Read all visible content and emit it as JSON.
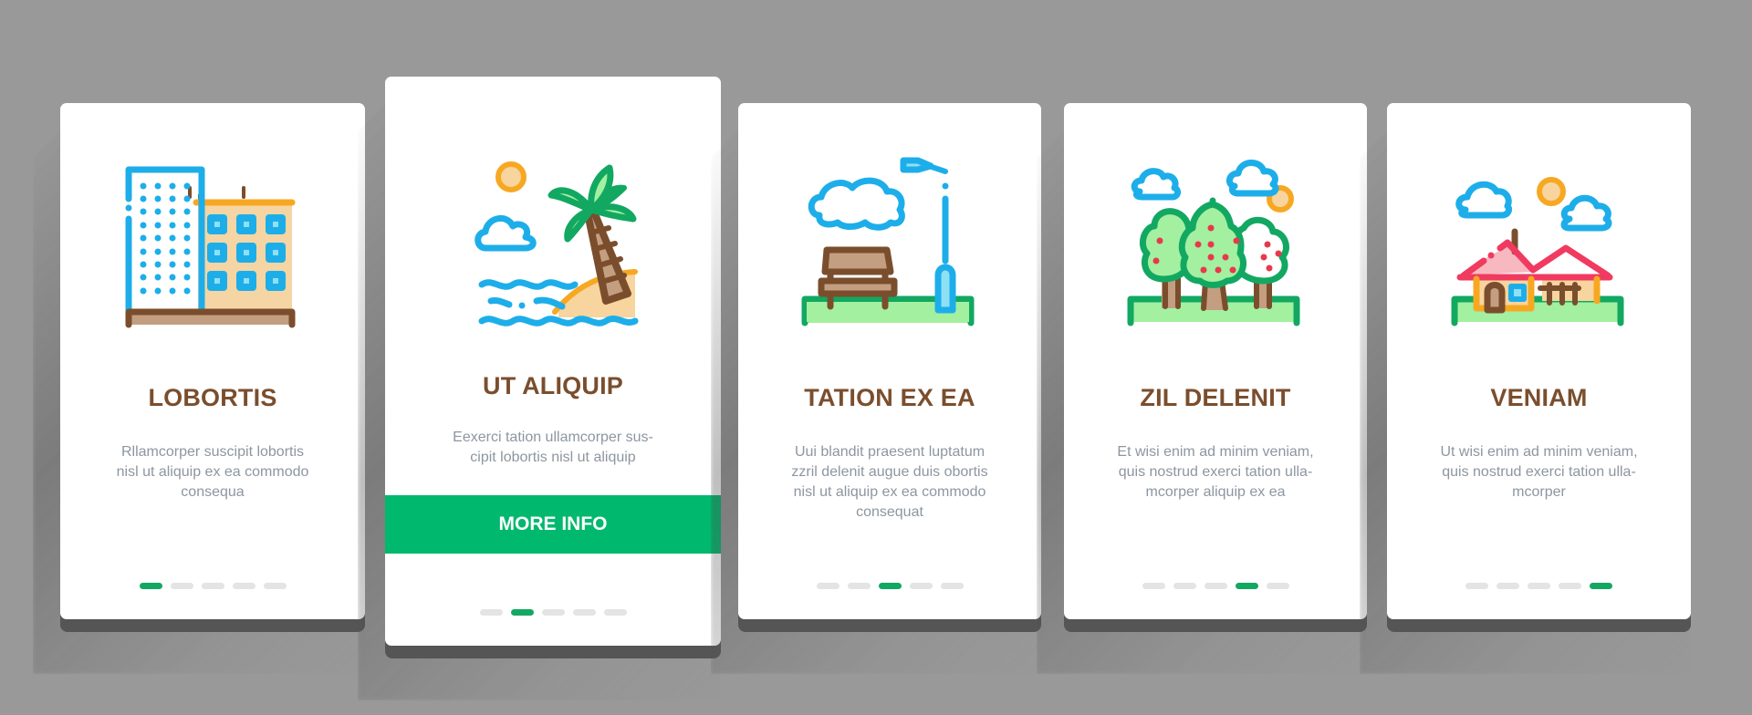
{
  "colors": {
    "background": "#999999",
    "title": "#7A4E2D",
    "description": "#8D96A0",
    "accent_green": "#00B86E",
    "dot_active": "#12A862",
    "dot_inactive": "#E4E4E4"
  },
  "cards": [
    {
      "icon": "city-buildings-icon",
      "title": "LOBORTIS",
      "description_lines": [
        "Rllamcorper suscipit lobortis",
        "nisl ut aliquip ex ea commodo",
        "consequa"
      ],
      "active_page": 1,
      "total_pages": 5
    },
    {
      "icon": "tropical-island-palm-icon",
      "title": "UT ALIQUIP",
      "description_lines": [
        "Eexerci tation ullamcorper sus-",
        "cipit lobortis nisl ut aliquip"
      ],
      "button_label": "MORE INFO",
      "active_page": 2,
      "total_pages": 5
    },
    {
      "icon": "park-bench-lamp-icon",
      "title": "TATION EX EA",
      "description_lines": [
        "Uui blandit praesent luptatum",
        "zzril delenit augue duis obortis",
        "nisl ut aliquip ex ea commodo",
        "consequat"
      ],
      "active_page": 3,
      "total_pages": 5
    },
    {
      "icon": "fruit-trees-icon",
      "title": "ZIL DELENIT",
      "description_lines": [
        "Et wisi enim ad minim veniam,",
        "quis nostrud exerci tation ulla-",
        "mcorper aliquip ex ea"
      ],
      "active_page": 4,
      "total_pages": 5
    },
    {
      "icon": "country-house-icon",
      "title": "VENIAM",
      "description_lines": [
        "Ut wisi enim ad minim veniam,",
        "quis nostrud exerci tation ulla-",
        "mcorper"
      ],
      "active_page": 5,
      "total_pages": 5
    }
  ]
}
